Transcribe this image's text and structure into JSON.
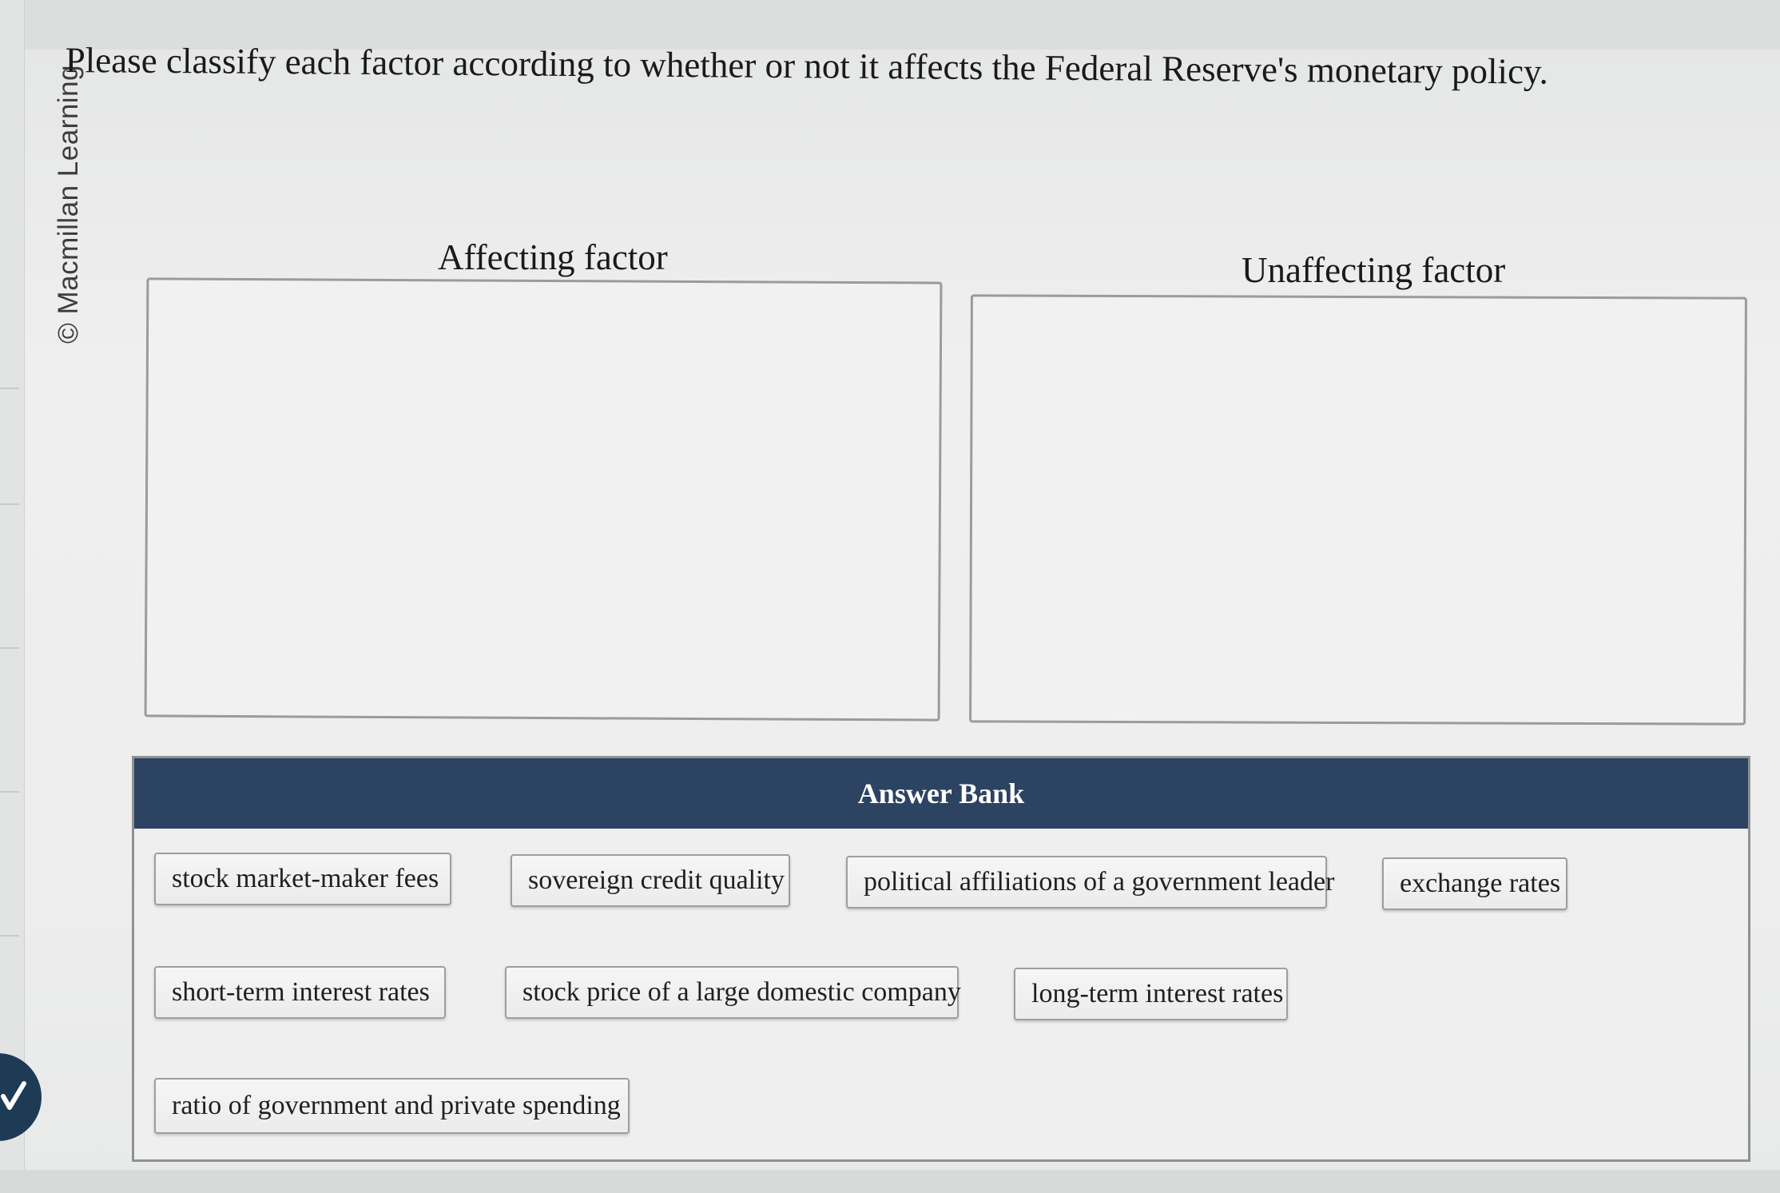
{
  "credit": "© Macmillan Learning",
  "question": "Please classify each factor according to whether or not it affects the Federal Reserve's monetary policy.",
  "zones": {
    "affecting_label": "Affecting factor",
    "unaffecting_label": "Unaffecting factor"
  },
  "answer_bank": {
    "title": "Answer Bank",
    "items": [
      "stock market-maker fees",
      "sovereign credit quality",
      "political affiliations of a government leader",
      "exchange rates",
      "short-term interest rates",
      "stock price of a large domestic company",
      "long-term interest rates",
      "ratio of government and private spending"
    ]
  },
  "colors": {
    "bank_header": "#2c4361",
    "nav_button": "#1d3b55"
  },
  "icons": {
    "nav": "chevron-icon"
  }
}
